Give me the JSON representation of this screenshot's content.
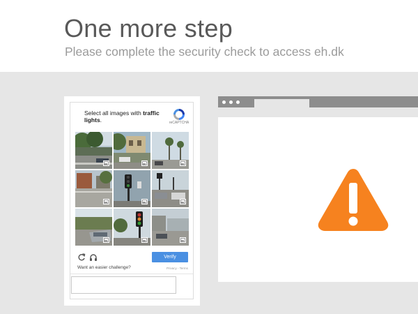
{
  "page": {
    "title": "One more step",
    "subtitle": "Please complete the security check to access eh.dk"
  },
  "captcha": {
    "instruction_prefix": "Select all images with ",
    "instruction_bold": "traffic lights",
    "instruction_suffix": ".",
    "brand_label": "reCAPTCHA",
    "verify_label": "Verify",
    "easier_challenge": "Want an easier challenge?",
    "privacy_terms": "Privacy - Terms",
    "answer_value": "",
    "icons": {
      "reload": "reload-icon",
      "audio": "headphones-icon",
      "logo": "recaptcha-logo-icon"
    },
    "tiles": [
      {
        "name": "street-with-trees"
      },
      {
        "name": "building-and-cars"
      },
      {
        "name": "palm-trees-street"
      },
      {
        "name": "parking-lot"
      },
      {
        "name": "traffic-light-tall"
      },
      {
        "name": "intersection-cars"
      },
      {
        "name": "parked-car"
      },
      {
        "name": "traffic-light-close"
      },
      {
        "name": "cross-street"
      }
    ]
  },
  "illustration": {
    "warning_color": "#f6821f",
    "browser_frame_color": "#8d8d8d"
  },
  "colors": {
    "verify_button": "#4a90e2",
    "background": "#e6e6e6"
  }
}
